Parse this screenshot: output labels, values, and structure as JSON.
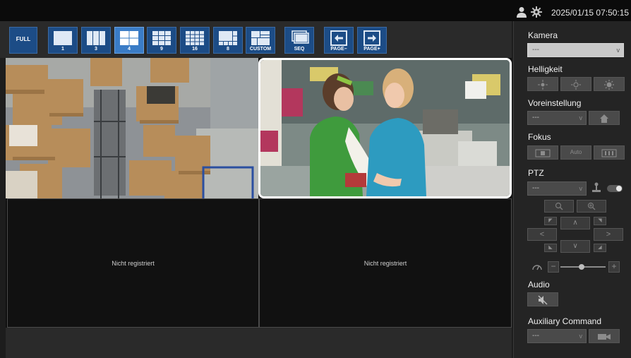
{
  "topbar": {
    "datetime": "2025/01/15 07:50:15",
    "icons": [
      "user-icon",
      "gear-icon"
    ]
  },
  "toolbar": {
    "buttons": [
      {
        "id": "full",
        "label": "FULL",
        "icon": "full-screen-icon"
      },
      {
        "id": "1",
        "label": "1",
        "icon": "layout-1-icon"
      },
      {
        "id": "3",
        "label": "3",
        "icon": "layout-3-icon"
      },
      {
        "id": "4",
        "label": "4",
        "icon": "layout-4-icon",
        "active": true
      },
      {
        "id": "9",
        "label": "9",
        "icon": "layout-9-icon"
      },
      {
        "id": "16",
        "label": "16",
        "icon": "layout-16-icon"
      },
      {
        "id": "8",
        "label": "8",
        "icon": "layout-8-icon"
      },
      {
        "id": "custom",
        "label": "CUSTOM",
        "icon": "layout-custom-icon"
      },
      {
        "id": "seq",
        "label": "SEQ",
        "icon": "sequence-icon"
      },
      {
        "id": "page-minus",
        "label": "PAGE–",
        "icon": "arrow-left-icon"
      },
      {
        "id": "page-plus",
        "label": "PAGE+",
        "icon": "arrow-right-icon"
      }
    ]
  },
  "grid": {
    "cells": [
      {
        "id": "cam1",
        "kind": "video",
        "scene": "warehouse"
      },
      {
        "id": "cam2",
        "kind": "video",
        "scene": "checkout",
        "selected": true
      },
      {
        "id": "cam3",
        "kind": "empty",
        "text": "Nicht registriert"
      },
      {
        "id": "cam4",
        "kind": "empty",
        "text": "Nicht registriert"
      }
    ]
  },
  "panel": {
    "camera": {
      "title": "Kamera",
      "value": "---"
    },
    "brightness": {
      "title": "Helligkeit"
    },
    "preset": {
      "title": "Voreinstellung",
      "value": "---"
    },
    "focus": {
      "title": "Fokus",
      "auto_label": "Auto"
    },
    "ptz": {
      "title": "PTZ",
      "value": "---"
    },
    "audio": {
      "title": "Audio"
    },
    "aux": {
      "title": "Auxiliary Command",
      "value": "---"
    }
  },
  "colors": {
    "button_blue": "#1c4c86",
    "button_active": "#3a7cc6",
    "panel_bg": "#242424",
    "selected_border": "#ffffff"
  }
}
